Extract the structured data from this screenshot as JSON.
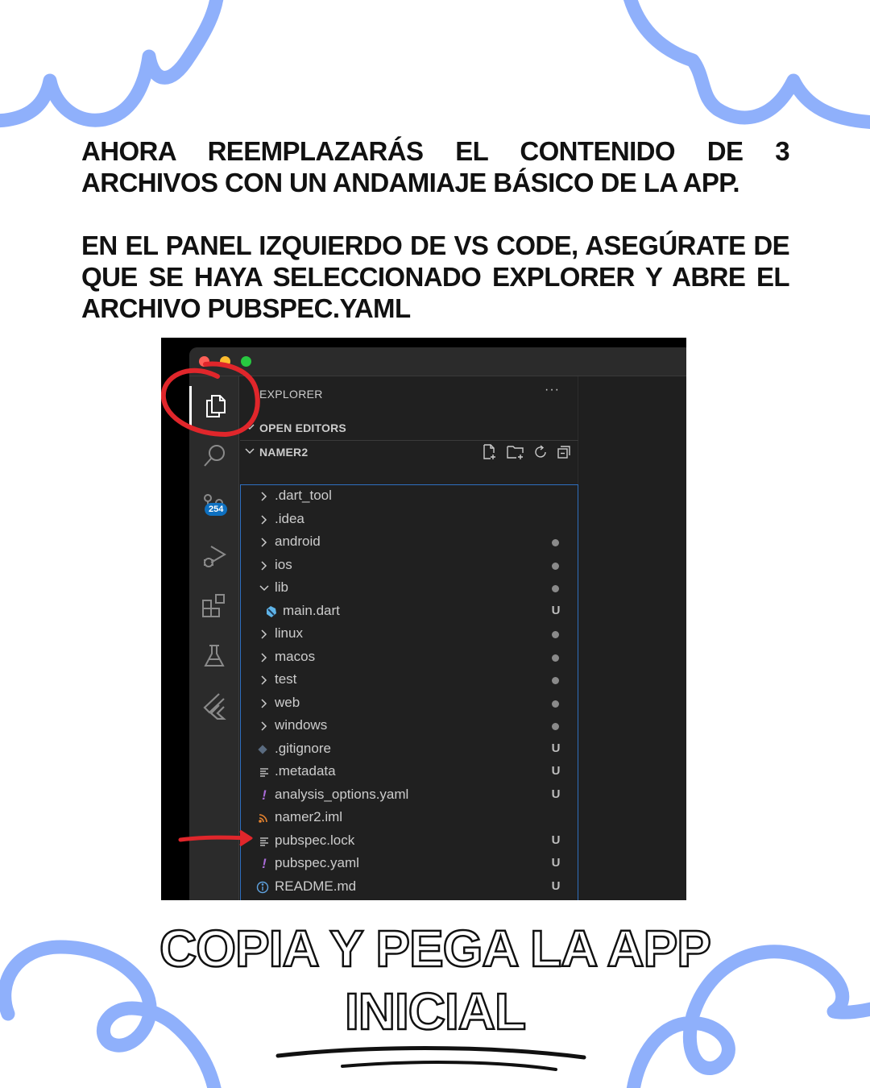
{
  "intro": {
    "paragraph1": "AHORA REEMPLAZARÁS EL CONTENIDO DE 3 ARCHIVOS CON UN ANDAMIAJE BÁSICO DE LA APP.",
    "paragraph2": "EN EL PANEL IZQUIERDO DE VS CODE, ASEGÚRATE DE QUE SE HAYA SELECCIONADO EXPLORER Y ABRE EL ARCHIVO PUBSPEC.YAML"
  },
  "vscode": {
    "activity_bar": {
      "items": [
        "explorer-icon",
        "search-icon",
        "source-control-icon",
        "run-debug-icon",
        "extensions-icon",
        "testing-icon",
        "flutter-icon"
      ],
      "source_control_badge": "254"
    },
    "explorer": {
      "title": "EXPLORER",
      "more": "···",
      "open_editors": "OPEN EDITORS",
      "project": "NAMER2",
      "files": [
        {
          "name": ".dart_tool",
          "kind": "folder",
          "status": ""
        },
        {
          "name": ".idea",
          "kind": "folder",
          "status": ""
        },
        {
          "name": "android",
          "kind": "folder",
          "status": "•"
        },
        {
          "name": "ios",
          "kind": "folder",
          "status": "•"
        },
        {
          "name": "lib",
          "kind": "folder-open",
          "status": "•"
        },
        {
          "name": "main.dart",
          "kind": "dart-file",
          "status": "U"
        },
        {
          "name": "linux",
          "kind": "folder",
          "status": "•"
        },
        {
          "name": "macos",
          "kind": "folder",
          "status": "•"
        },
        {
          "name": "test",
          "kind": "folder",
          "status": "•"
        },
        {
          "name": "web",
          "kind": "folder",
          "status": "•"
        },
        {
          "name": "windows",
          "kind": "folder",
          "status": "•"
        },
        {
          "name": ".gitignore",
          "kind": "git-file",
          "status": "U"
        },
        {
          "name": ".metadata",
          "kind": "text-file",
          "status": "U"
        },
        {
          "name": "analysis_options.yaml",
          "kind": "yaml-file",
          "status": "U"
        },
        {
          "name": "namer2.iml",
          "kind": "rss-file",
          "status": ""
        },
        {
          "name": "pubspec.lock",
          "kind": "text-file",
          "status": "U"
        },
        {
          "name": "pubspec.yaml",
          "kind": "yaml-file",
          "status": "U"
        },
        {
          "name": "README.md",
          "kind": "info-file",
          "status": "U"
        }
      ]
    }
  },
  "cta": {
    "line1": "COPIA Y PEGA LA APP",
    "line2": "INICIAL"
  },
  "colors": {
    "decoration_blue": "#8fb0fb",
    "annotation_red": "#e0262b",
    "selection_border": "#2f6fbf",
    "badge_blue": "#0e70c0"
  }
}
